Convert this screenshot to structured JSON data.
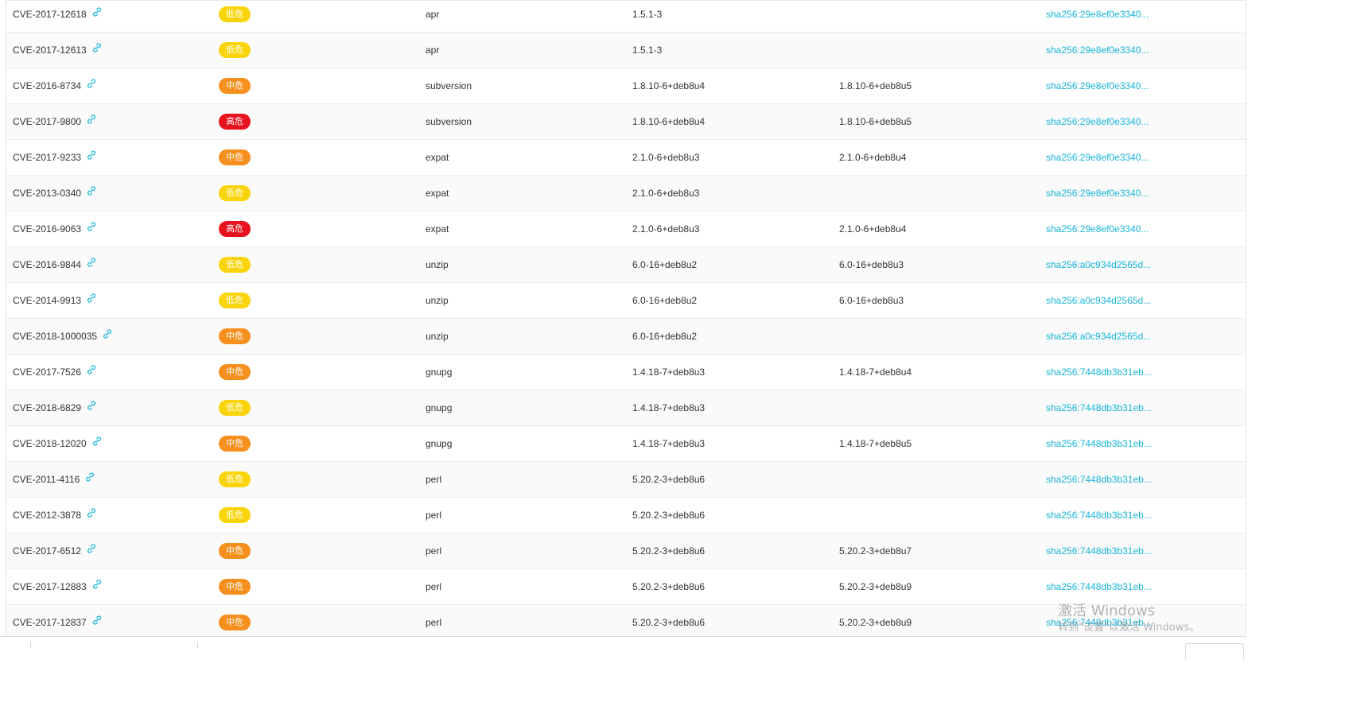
{
  "colors": {
    "link": "#17b5d8",
    "badge_low": "#f9d40a",
    "badge_mid": "#f5901e",
    "badge_high": "#e6121d"
  },
  "rows": [
    {
      "cve": "CVE-2017-12618",
      "level": "低危",
      "severity": "low",
      "package": "apr",
      "version": "1.5.1-3",
      "fixed": "",
      "layer": "sha256:29e8ef0e3340..."
    },
    {
      "cve": "CVE-2017-12613",
      "level": "低危",
      "severity": "low",
      "package": "apr",
      "version": "1.5.1-3",
      "fixed": "",
      "layer": "sha256:29e8ef0e3340..."
    },
    {
      "cve": "CVE-2016-8734",
      "level": "中危",
      "severity": "mid",
      "package": "subversion",
      "version": "1.8.10-6+deb8u4",
      "fixed": "1.8.10-6+deb8u5",
      "layer": "sha256:29e8ef0e3340..."
    },
    {
      "cve": "CVE-2017-9800",
      "level": "高危",
      "severity": "high",
      "package": "subversion",
      "version": "1.8.10-6+deb8u4",
      "fixed": "1.8.10-6+deb8u5",
      "layer": "sha256:29e8ef0e3340..."
    },
    {
      "cve": "CVE-2017-9233",
      "level": "中危",
      "severity": "mid",
      "package": "expat",
      "version": "2.1.0-6+deb8u3",
      "fixed": "2.1.0-6+deb8u4",
      "layer": "sha256:29e8ef0e3340..."
    },
    {
      "cve": "CVE-2013-0340",
      "level": "低危",
      "severity": "low",
      "package": "expat",
      "version": "2.1.0-6+deb8u3",
      "fixed": "",
      "layer": "sha256:29e8ef0e3340..."
    },
    {
      "cve": "CVE-2016-9063",
      "level": "高危",
      "severity": "high",
      "package": "expat",
      "version": "2.1.0-6+deb8u3",
      "fixed": "2.1.0-6+deb8u4",
      "layer": "sha256:29e8ef0e3340..."
    },
    {
      "cve": "CVE-2016-9844",
      "level": "低危",
      "severity": "low",
      "package": "unzip",
      "version": "6.0-16+deb8u2",
      "fixed": "6.0-16+deb8u3",
      "layer": "sha256:a0c934d2565d..."
    },
    {
      "cve": "CVE-2014-9913",
      "level": "低危",
      "severity": "low",
      "package": "unzip",
      "version": "6.0-16+deb8u2",
      "fixed": "6.0-16+deb8u3",
      "layer": "sha256:a0c934d2565d..."
    },
    {
      "cve": "CVE-2018-1000035",
      "level": "中危",
      "severity": "mid",
      "package": "unzip",
      "version": "6.0-16+deb8u2",
      "fixed": "",
      "layer": "sha256:a0c934d2565d..."
    },
    {
      "cve": "CVE-2017-7526",
      "level": "中危",
      "severity": "mid",
      "package": "gnupg",
      "version": "1.4.18-7+deb8u3",
      "fixed": "1.4.18-7+deb8u4",
      "layer": "sha256:7448db3b31eb..."
    },
    {
      "cve": "CVE-2018-6829",
      "level": "低危",
      "severity": "low",
      "package": "gnupg",
      "version": "1.4.18-7+deb8u3",
      "fixed": "",
      "layer": "sha256:7448db3b31eb..."
    },
    {
      "cve": "CVE-2018-12020",
      "level": "中危",
      "severity": "mid",
      "package": "gnupg",
      "version": "1.4.18-7+deb8u3",
      "fixed": "1.4.18-7+deb8u5",
      "layer": "sha256:7448db3b31eb..."
    },
    {
      "cve": "CVE-2011-4116",
      "level": "低危",
      "severity": "low",
      "package": "perl",
      "version": "5.20.2-3+deb8u6",
      "fixed": "",
      "layer": "sha256:7448db3b31eb..."
    },
    {
      "cve": "CVE-2012-3878",
      "level": "低危",
      "severity": "low",
      "package": "perl",
      "version": "5.20.2-3+deb8u6",
      "fixed": "",
      "layer": "sha256:7448db3b31eb..."
    },
    {
      "cve": "CVE-2017-6512",
      "level": "中危",
      "severity": "mid",
      "package": "perl",
      "version": "5.20.2-3+deb8u6",
      "fixed": "5.20.2-3+deb8u7",
      "layer": "sha256:7448db3b31eb..."
    },
    {
      "cve": "CVE-2017-12883",
      "level": "中危",
      "severity": "mid",
      "package": "perl",
      "version": "5.20.2-3+deb8u6",
      "fixed": "5.20.2-3+deb8u9",
      "layer": "sha256:7448db3b31eb..."
    },
    {
      "cve": "CVE-2017-12837",
      "level": "中危",
      "severity": "mid",
      "package": "perl",
      "version": "5.20.2-3+deb8u6",
      "fixed": "5.20.2-3+deb8u9",
      "layer": "sha256:7448db3b31eb..."
    }
  ],
  "watermark": {
    "title": "激活 Windows",
    "subtitle": "转到\"设置\"以激活 Windows。"
  }
}
